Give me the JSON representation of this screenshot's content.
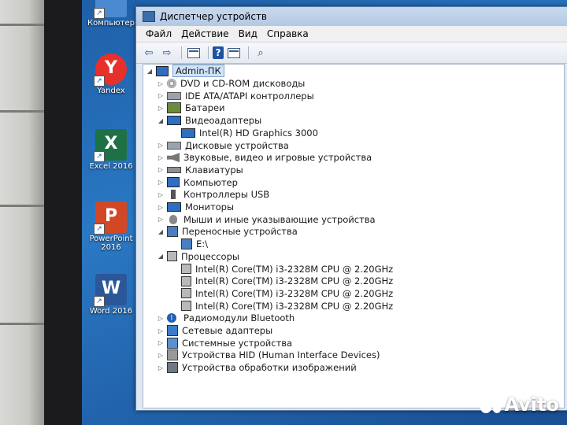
{
  "desktop": {
    "icons": [
      {
        "label": "Компьютер",
        "glyph": "",
        "color": "#4b8ad1"
      },
      {
        "label": "Yandex",
        "glyph": "Y",
        "color": "#e8302a"
      },
      {
        "label": "Excel 2016",
        "glyph": "X",
        "color": "#1e7145"
      },
      {
        "label": "PowerPoint 2016",
        "glyph": "P",
        "color": "#d24726"
      },
      {
        "label": "Word 2016",
        "glyph": "W",
        "color": "#2b579a"
      }
    ]
  },
  "window": {
    "title": "Диспетчер устройств",
    "menu": [
      "Файл",
      "Действие",
      "Вид",
      "Справка"
    ],
    "toolbar": {
      "back": "back-arrow-icon",
      "forward": "forward-arrow-icon",
      "help": "?"
    }
  },
  "tree": {
    "root": "Admin-ПК",
    "items": [
      {
        "label": "DVD и CD-ROM дисководы",
        "level": 1,
        "expanded": false,
        "icon": "dvd-drive-icon"
      },
      {
        "label": "IDE ATA/ATAPI контроллеры",
        "level": 1,
        "expanded": false,
        "icon": "ide-controller-icon"
      },
      {
        "label": "Батареи",
        "level": 1,
        "expanded": false,
        "icon": "battery-icon"
      },
      {
        "label": "Видеоадаптеры",
        "level": 1,
        "expanded": true,
        "icon": "display-adapter-icon"
      },
      {
        "label": "Intel(R) HD Graphics 3000",
        "level": 2,
        "icon": "display-adapter-icon"
      },
      {
        "label": "Дисковые устройства",
        "level": 1,
        "expanded": false,
        "icon": "disk-drive-icon"
      },
      {
        "label": "Звуковые, видео и игровые устройства",
        "level": 1,
        "expanded": false,
        "icon": "speaker-icon"
      },
      {
        "label": "Клавиатуры",
        "level": 1,
        "expanded": false,
        "icon": "keyboard-icon"
      },
      {
        "label": "Компьютер",
        "level": 1,
        "expanded": false,
        "icon": "computer-icon"
      },
      {
        "label": "Контроллеры USB",
        "level": 1,
        "expanded": false,
        "icon": "usb-icon"
      },
      {
        "label": "Мониторы",
        "level": 1,
        "expanded": false,
        "icon": "monitor-icon"
      },
      {
        "label": "Мыши и иные указывающие устройства",
        "level": 1,
        "expanded": false,
        "icon": "mouse-icon"
      },
      {
        "label": "Переносные устройства",
        "level": 1,
        "expanded": true,
        "icon": "portable-device-icon"
      },
      {
        "label": "E:\\",
        "level": 2,
        "icon": "portable-device-icon"
      },
      {
        "label": "Процессоры",
        "level": 1,
        "expanded": true,
        "icon": "processor-icon"
      },
      {
        "label": "Intel(R) Core(TM) i3-2328M CPU @ 2.20GHz",
        "level": 2,
        "icon": "processor-icon"
      },
      {
        "label": "Intel(R) Core(TM) i3-2328M CPU @ 2.20GHz",
        "level": 2,
        "icon": "processor-icon"
      },
      {
        "label": "Intel(R) Core(TM) i3-2328M CPU @ 2.20GHz",
        "level": 2,
        "icon": "processor-icon"
      },
      {
        "label": "Intel(R) Core(TM) i3-2328M CPU @ 2.20GHz",
        "level": 2,
        "icon": "processor-icon"
      },
      {
        "label": "Радиомодули Bluetooth",
        "level": 1,
        "expanded": false,
        "icon": "bluetooth-icon"
      },
      {
        "label": "Сетевые адаптеры",
        "level": 1,
        "expanded": false,
        "icon": "network-adapter-icon"
      },
      {
        "label": "Системные устройства",
        "level": 1,
        "expanded": false,
        "icon": "system-device-icon"
      },
      {
        "label": "Устройства HID (Human Interface Devices)",
        "level": 1,
        "expanded": false,
        "icon": "hid-icon"
      },
      {
        "label": "Устройства обработки изображений",
        "level": 1,
        "expanded": false,
        "icon": "imaging-device-icon"
      }
    ]
  },
  "watermark": {
    "text": "Avito"
  }
}
